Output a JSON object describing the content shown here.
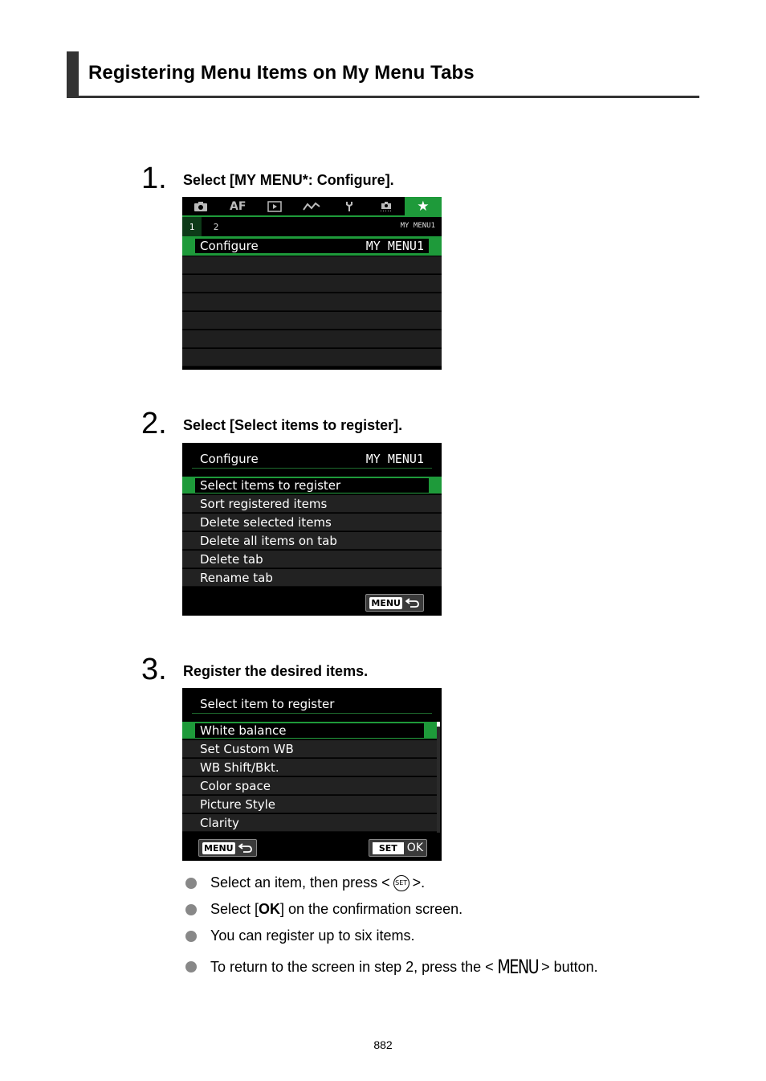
{
  "section": {
    "title": "Registering Menu Items on My Menu Tabs"
  },
  "steps": [
    {
      "number": "1.",
      "title": "Select [MY MENU*: Configure]."
    },
    {
      "number": "2.",
      "title": "Select [Select items to register]."
    },
    {
      "number": "3.",
      "title": "Register the desired items."
    }
  ],
  "screen1": {
    "tabs": [
      {
        "icon": "camera-icon",
        "label": ""
      },
      {
        "icon": "af-icon",
        "label": "AF"
      },
      {
        "icon": "playback-icon",
        "label": ""
      },
      {
        "icon": "wireless-icon",
        "label": ""
      },
      {
        "icon": "wrench-icon",
        "label": ""
      },
      {
        "icon": "custom-functions-icon",
        "label": ""
      },
      {
        "icon": "star-icon",
        "label": "★"
      }
    ],
    "subtabs": [
      "1",
      "2"
    ],
    "subtab_label": "MY MENU1",
    "selected_item": {
      "label": "Configure",
      "value": "MY MENU1"
    }
  },
  "screen2": {
    "header_title": "Configure",
    "header_value": "MY MENU1",
    "items": [
      "Select items to register",
      "Sort registered items",
      "Delete selected items",
      "Delete all items on tab",
      "Delete tab",
      "Rename tab"
    ],
    "menu_button": "MENU"
  },
  "screen3": {
    "header_title": "Select item to register",
    "items": [
      "White balance",
      "Set Custom WB",
      "WB Shift/Bkt.",
      "Color space",
      "Picture Style",
      "Clarity"
    ],
    "menu_button": "MENU",
    "set_button": "SET",
    "ok_label": "OK"
  },
  "bullets": {
    "b1_pre": "Select an item, then press <",
    "b1_icon": "SET",
    "b1_post": ">.",
    "b2_pre": "Select [",
    "b2_bold": "OK",
    "b2_post": "] on the confirmation screen.",
    "b3": "You can register up to six items.",
    "b4_pre": "To return to the screen in step 2, press the <",
    "b4_icon": "MENU",
    "b4_post": "> button."
  },
  "page_number": "882"
}
